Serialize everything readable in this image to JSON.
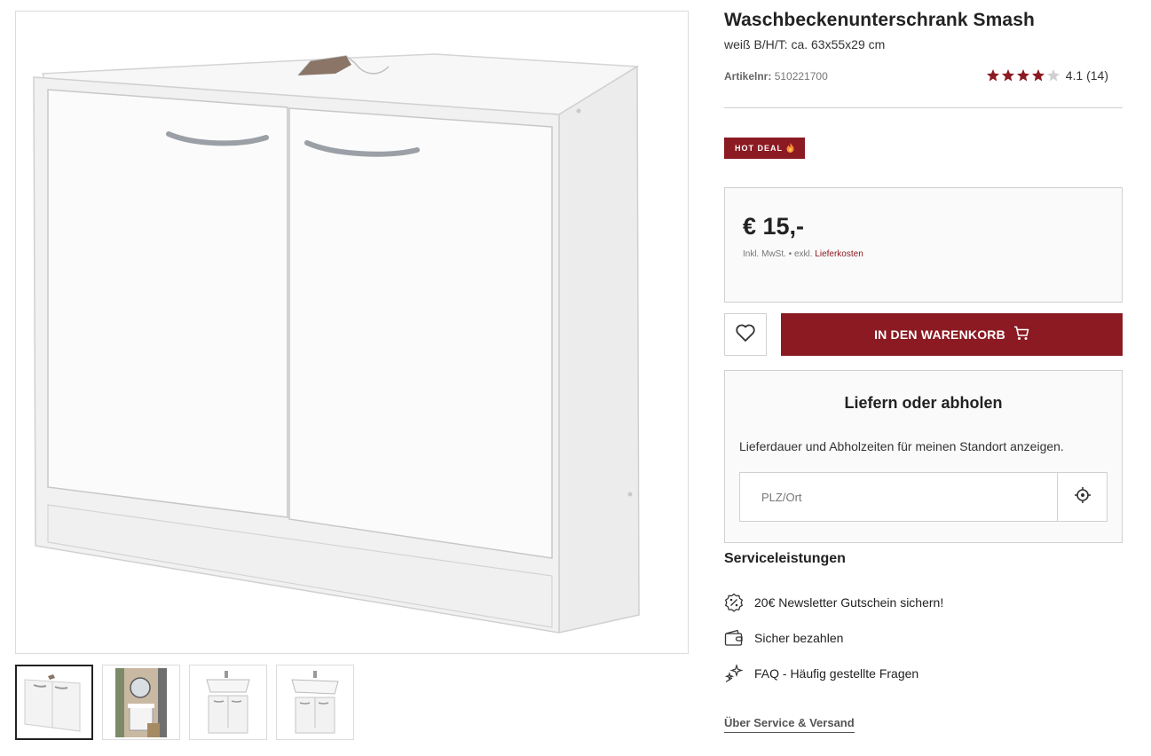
{
  "product": {
    "title": "Waschbeckenunterschrank Smash",
    "subtitle": "weiß B/H/T: ca. 63x55x29 cm",
    "article_label": "Artikelnr:",
    "article_number": "510221700",
    "rating_value": 4.1,
    "rating_text": "4.1 (14)",
    "badge": "HOT DEAL",
    "badge_icon": "flame-icon"
  },
  "price": {
    "amount": "€ 15,-",
    "tax_note": "Inkl. MwSt. • exkl.",
    "shipping_link": "Lieferkosten"
  },
  "actions": {
    "wishlist_icon": "heart-icon",
    "cart_label": "IN DEN WARENKORB",
    "cart_icon": "cart-icon"
  },
  "delivery": {
    "title": "Liefern oder abholen",
    "description": "Lieferdauer und Abholzeiten für meinen Standort anzeigen.",
    "placeholder": "PLZ/Ort",
    "locate_icon": "crosshair-icon"
  },
  "services": {
    "title": "Serviceleistungen",
    "items": [
      {
        "label": "20€ Newsletter Gutschein sichern!",
        "icon": "percent-badge-icon"
      },
      {
        "label": "Sicher bezahlen",
        "icon": "wallet-icon"
      },
      {
        "label": "FAQ - Häufig gestellte Fragen",
        "icon": "sparkle-icon"
      }
    ],
    "about_link": "Über Service & Versand"
  },
  "gallery": {
    "active_index": 0,
    "thumbnails": [
      "cabinet-front",
      "bathroom-scene",
      "cabinet-with-sink",
      "cabinet-with-sink-side"
    ]
  },
  "colors": {
    "brand": "#8b1a22",
    "star": "#8b1a22",
    "star_empty": "#d0d0d0"
  }
}
